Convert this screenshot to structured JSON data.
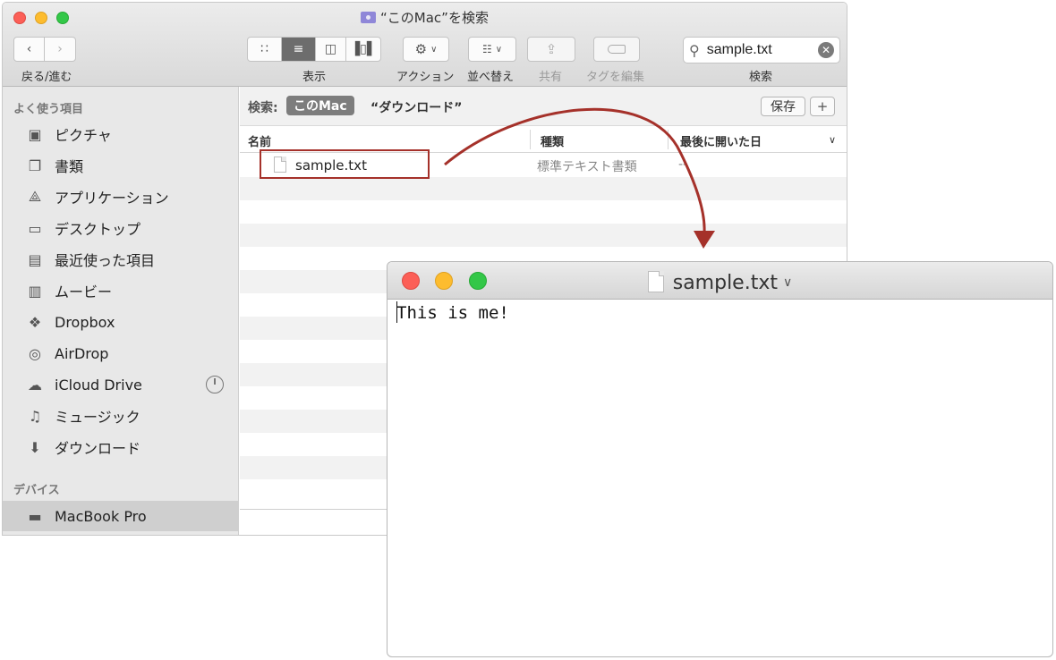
{
  "finder": {
    "title": "“このMac”を検索",
    "toolbar": {
      "back_forward_label": "戻る/進む",
      "view_label": "表示",
      "action_label": "アクション",
      "arrange_label": "並べ替え",
      "share_label": "共有",
      "tags_label": "タグを編集",
      "search_label": "検索"
    },
    "search": {
      "value": "sample.txt"
    },
    "sidebar": {
      "favorites_header": "よく使う項目",
      "items": [
        {
          "label": "ピクチャ",
          "icon": "camera-icon"
        },
        {
          "label": "書類",
          "icon": "documents-icon"
        },
        {
          "label": "アプリケーション",
          "icon": "applications-icon"
        },
        {
          "label": "デスクトップ",
          "icon": "desktop-icon"
        },
        {
          "label": "最近使った項目",
          "icon": "recents-icon"
        },
        {
          "label": "ムービー",
          "icon": "film-icon"
        },
        {
          "label": "Dropbox",
          "icon": "dropbox-icon"
        },
        {
          "label": "AirDrop",
          "icon": "airdrop-icon"
        },
        {
          "label": "iCloud Drive",
          "icon": "cloud-icon"
        },
        {
          "label": "ミュージック",
          "icon": "music-note-icon"
        },
        {
          "label": "ダウンロード",
          "icon": "download-icon"
        }
      ],
      "devices_header": "デバイス",
      "devices": [
        {
          "label": "MacBook Pro",
          "icon": "laptop-icon"
        }
      ]
    },
    "scope": {
      "label": "検索:",
      "this_mac": "このMac",
      "downloads": "“ダウンロード”",
      "save_label": "保存",
      "add_label": "+"
    },
    "columns": {
      "name": "名前",
      "kind": "種類",
      "last_opened": "最後に開いた日"
    },
    "files": [
      {
        "name": "sample.txt",
        "kind": "標準テキスト書類",
        "last_opened": "--"
      }
    ]
  },
  "textedit": {
    "title": "sample.txt",
    "content": "This is me!"
  },
  "colors": {
    "highlight": "#a5312a",
    "arrow": "#a5312a"
  }
}
